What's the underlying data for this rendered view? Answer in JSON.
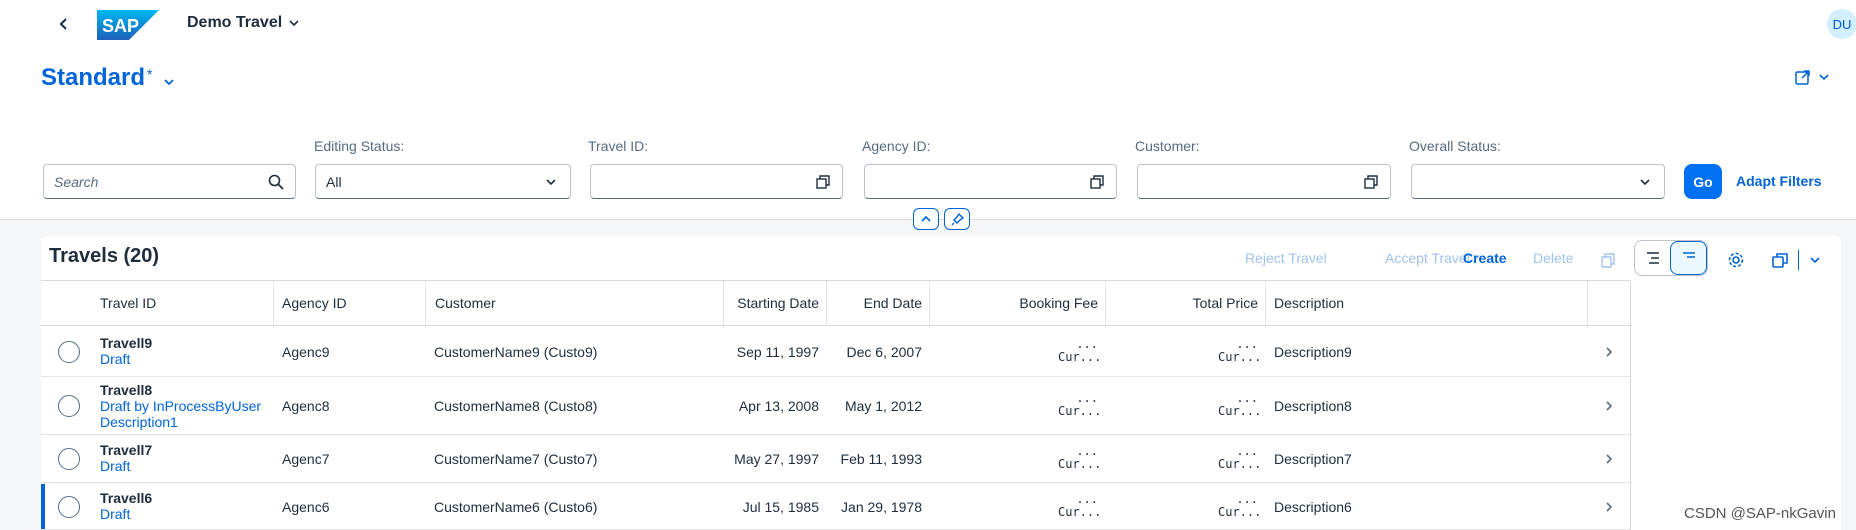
{
  "shell": {
    "logo": "SAP",
    "app_title": "Demo Travel",
    "avatar": "DU"
  },
  "header": {
    "variant": "Standard",
    "variant_modified": "*"
  },
  "filters": {
    "search_placeholder": "Search",
    "editing_status_label": "Editing Status:",
    "editing_status_value": "All",
    "travel_id_label": "Travel ID:",
    "agency_id_label": "Agency ID:",
    "customer_label": "Customer:",
    "overall_status_label": "Overall Status:",
    "go": "Go",
    "adapt": "Adapt Filters"
  },
  "table": {
    "title": "Travels (20)",
    "toolbar": {
      "reject": "Reject Travel",
      "accept": "Accept Travel",
      "create": "Create",
      "delete": "Delete"
    },
    "columns": [
      "Travel ID",
      "Agency ID",
      "Customer",
      "Starting Date",
      "End Date",
      "Booking Fee",
      "Total Price",
      "Description"
    ],
    "rows": [
      {
        "id": "Travell9",
        "status": "Draft",
        "status2": "",
        "agency": "Agenc9",
        "customer": "CustomerName9 (Custo9)",
        "start": "Sep 11, 1997",
        "end": "Dec 6, 2007",
        "fee_top": "...",
        "fee_bot": "Cur...",
        "price_top": "...",
        "price_bot": "Cur...",
        "desc": "Description9"
      },
      {
        "id": "Travell8",
        "status": "Draft by InProcessByUser",
        "status2": "Description1",
        "agency": "Agenc8",
        "customer": "CustomerName8 (Custo8)",
        "start": "Apr 13, 2008",
        "end": "May 1, 2012",
        "fee_top": "...",
        "fee_bot": "Cur...",
        "price_top": "...",
        "price_bot": "Cur...",
        "desc": "Description8"
      },
      {
        "id": "Travell7",
        "status": "Draft",
        "status2": "",
        "agency": "Agenc7",
        "customer": "CustomerName7 (Custo7)",
        "start": "May 27, 1997",
        "end": "Feb 11, 1993",
        "fee_top": "...",
        "fee_bot": "Cur...",
        "price_top": "...",
        "price_bot": "Cur...",
        "desc": "Description7"
      },
      {
        "id": "Travell6",
        "status": "Draft",
        "status2": "",
        "agency": "Agenc6",
        "customer": "CustomerName6 (Custo6)",
        "start": "Jul 15, 1985",
        "end": "Jan 29, 1978",
        "fee_top": "...",
        "fee_bot": "Cur...",
        "price_top": "...",
        "price_bot": "Cur...",
        "desc": "Description6"
      }
    ]
  },
  "watermark": "CSDN @SAP-nkGavin",
  "colors": {
    "brand": "#0064d9",
    "go": "#0070f2",
    "disabled": "#9fc3ed",
    "avatar_bg": "#d1efff"
  }
}
